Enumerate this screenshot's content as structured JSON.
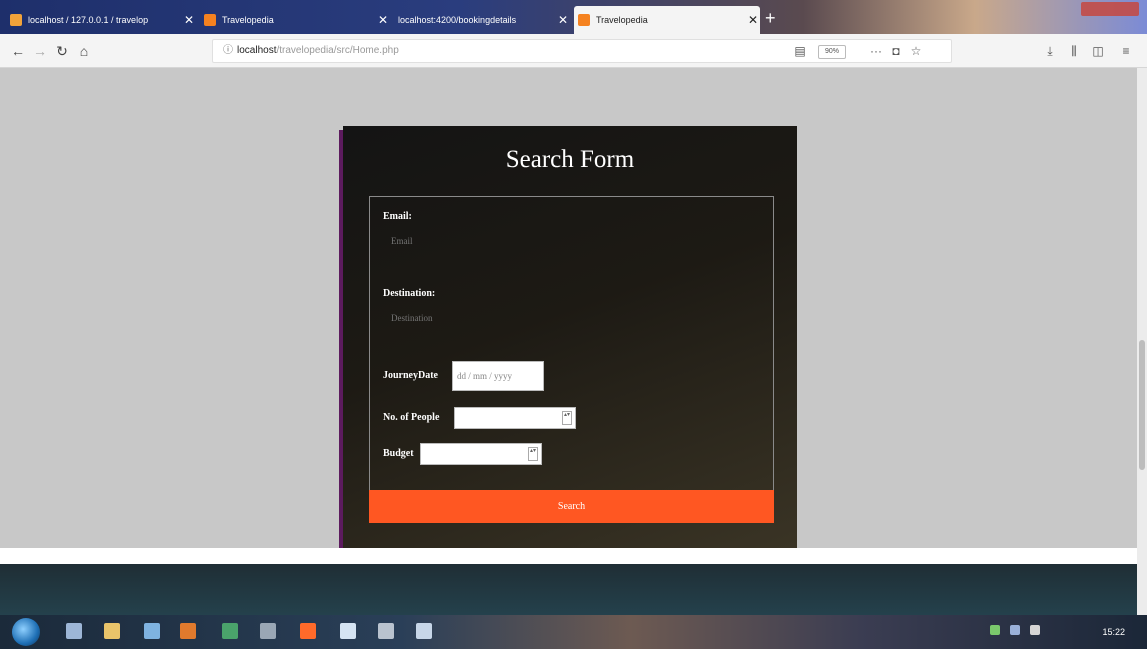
{
  "tabs": [
    {
      "title": "localhost / 127.0.0.1 / travelop",
      "favicon": "phpmyadmin-icon",
      "color": "#f2a33a"
    },
    {
      "title": "Travelopedia",
      "favicon": "travelopedia-icon",
      "color": "#f58220"
    },
    {
      "title": "localhost:4200/bookingdetails",
      "favicon": "page-icon",
      "color": "#8fa4c8"
    },
    {
      "title": "Travelopedia",
      "favicon": "travelopedia-icon",
      "color": "#f58220"
    }
  ],
  "new_tab_label": "+",
  "url": {
    "host": "localhost",
    "path": "/travelopedia/src/Home.php"
  },
  "zoom": "90%",
  "form": {
    "title": "Search Form",
    "email_label": "Email:",
    "email_placeholder": "Email",
    "destination_label": "Destination:",
    "destination_placeholder": "Destination",
    "journey_label": "JourneyDate",
    "journey_placeholder": "dd / mm / yyyy",
    "people_label": "No. of People",
    "budget_label": "Budget",
    "search_label": "Search"
  },
  "colors": {
    "search_button": "#ff5722",
    "card_shadow": "#5c1b5e"
  },
  "clock": "15:22"
}
